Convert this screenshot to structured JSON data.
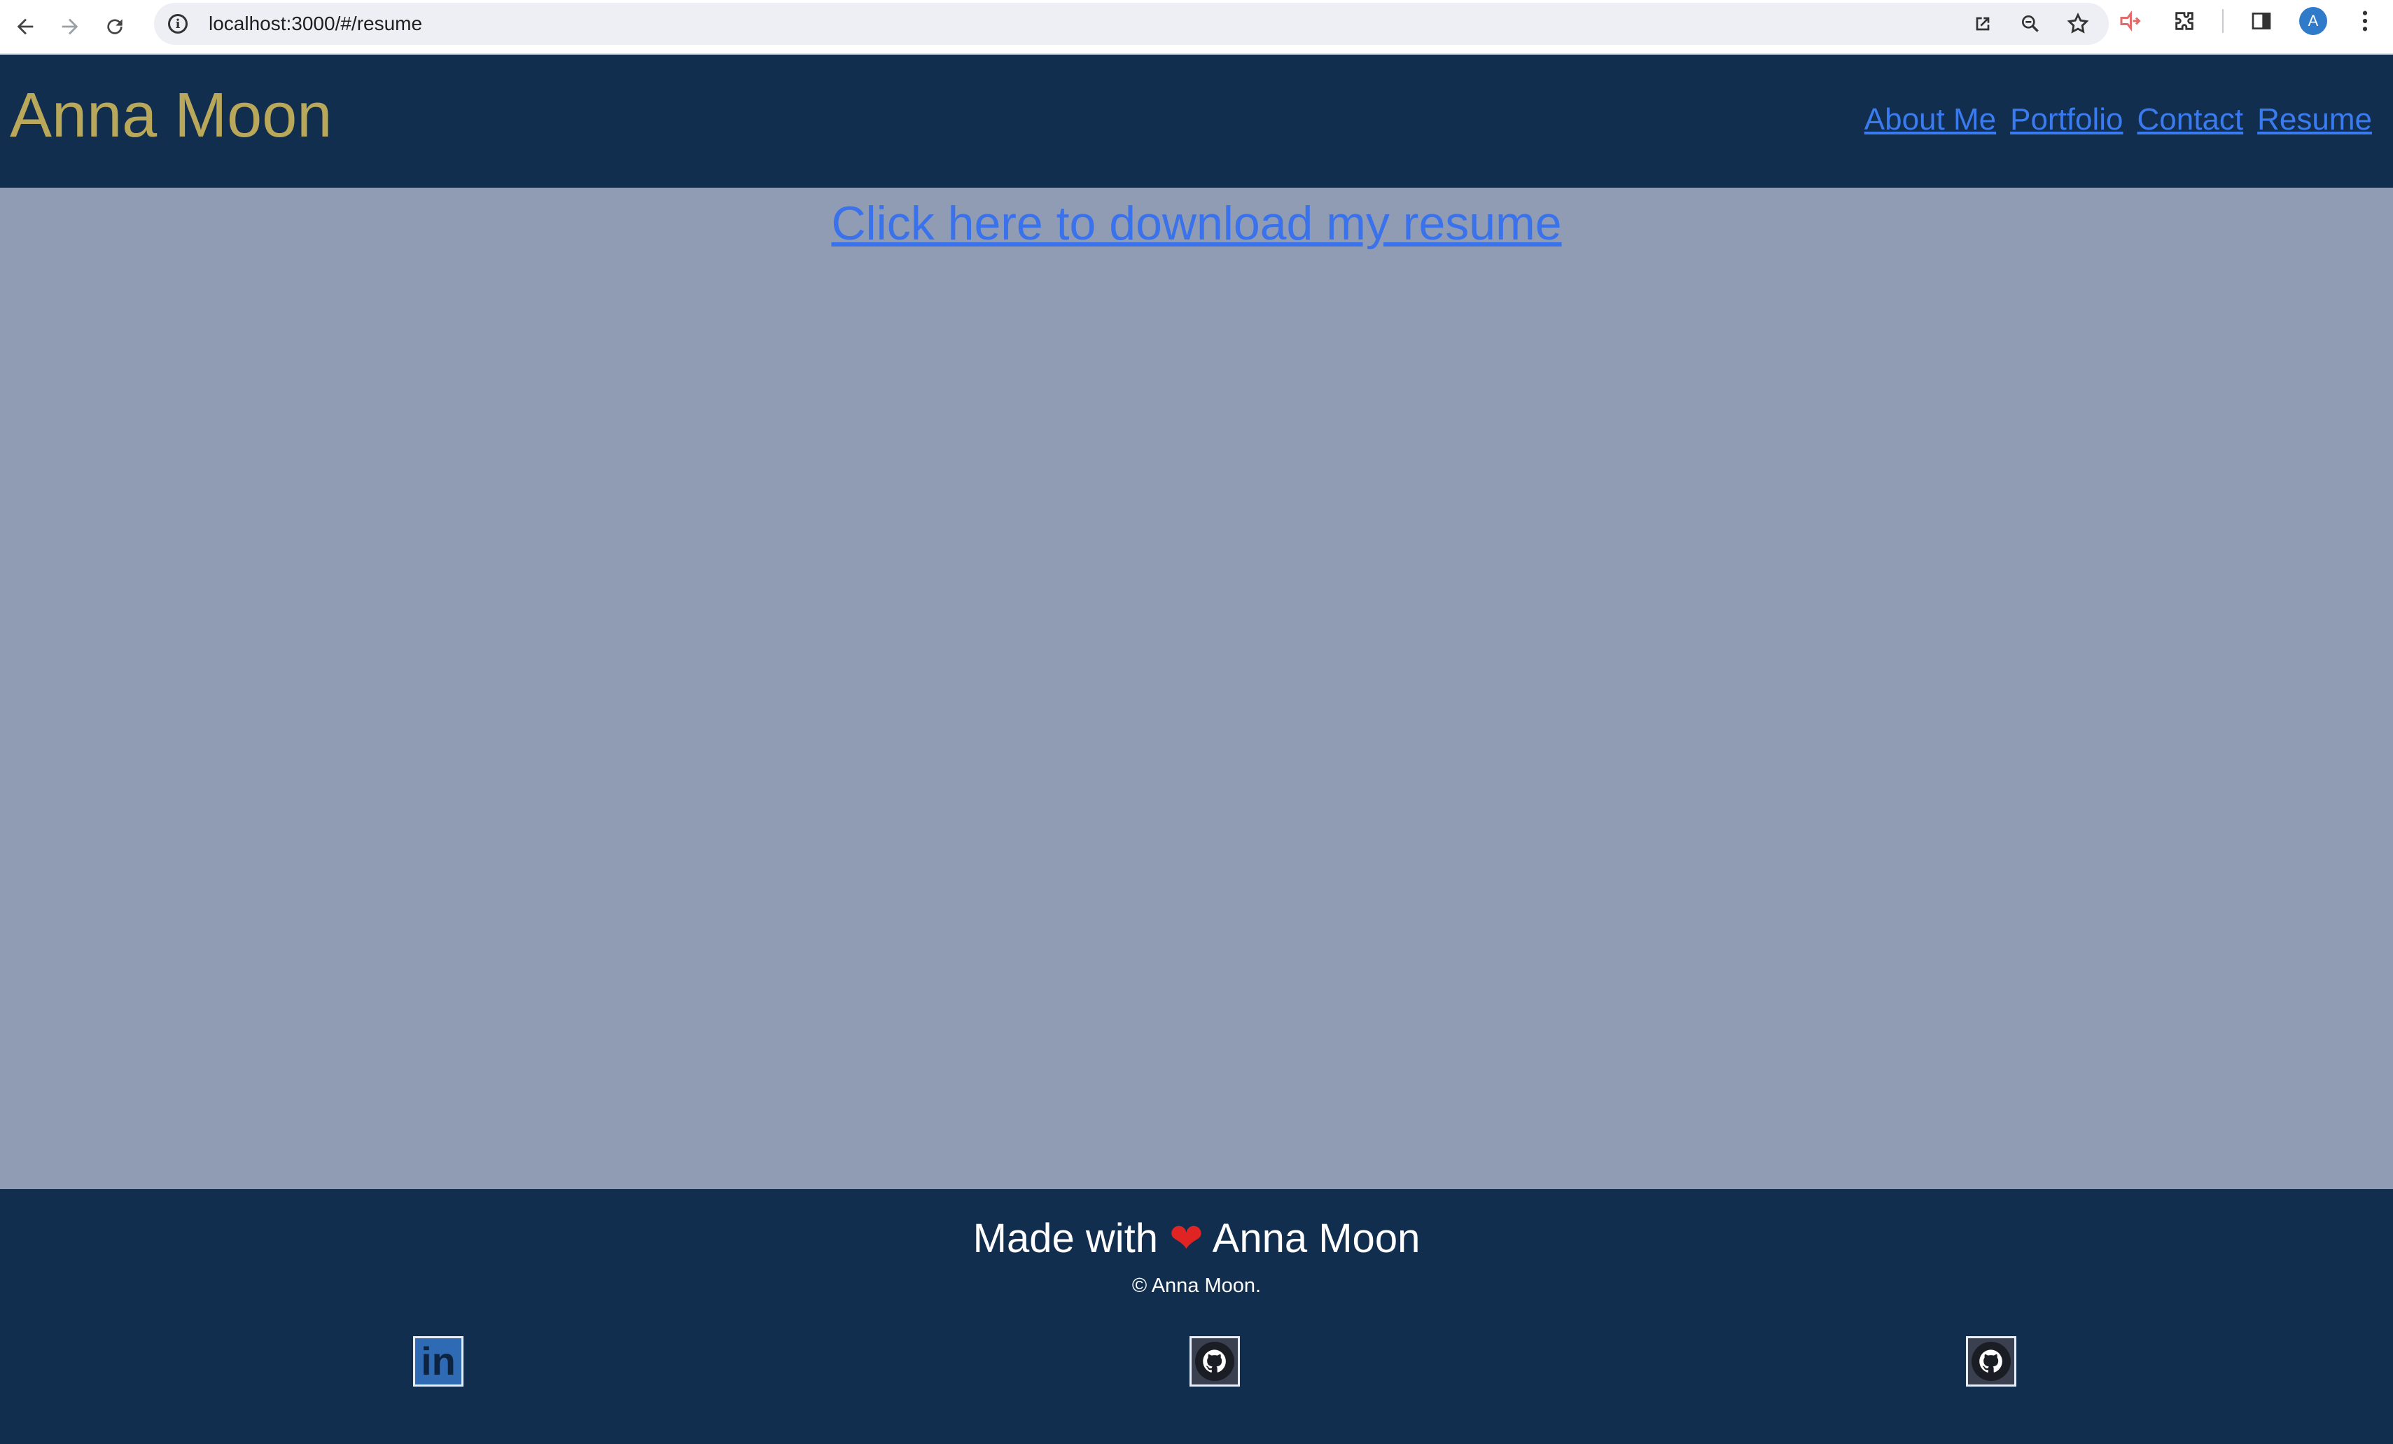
{
  "browser": {
    "url": "localhost:3000/#/resume",
    "avatar_letter": "A"
  },
  "header": {
    "brand": "Anna Moon",
    "nav": [
      "About Me",
      "Portfolio",
      "Contact",
      "Resume"
    ]
  },
  "main": {
    "download_link": "Click here to download my resume"
  },
  "footer": {
    "made_with_prefix": "Made with",
    "heart": "❤",
    "made_with_name": "Anna Moon",
    "copyright": "© Anna Moon.",
    "social": [
      {
        "name": "linkedin",
        "icon": "linkedin-icon",
        "text": "in"
      },
      {
        "name": "github",
        "icon": "github-icon"
      },
      {
        "name": "github",
        "icon": "github-icon"
      }
    ]
  },
  "colors": {
    "header_bg": "#112e4f",
    "page_bg": "#8f9cb3",
    "brand": "#b9a75a",
    "link": "#3a7bf0"
  }
}
